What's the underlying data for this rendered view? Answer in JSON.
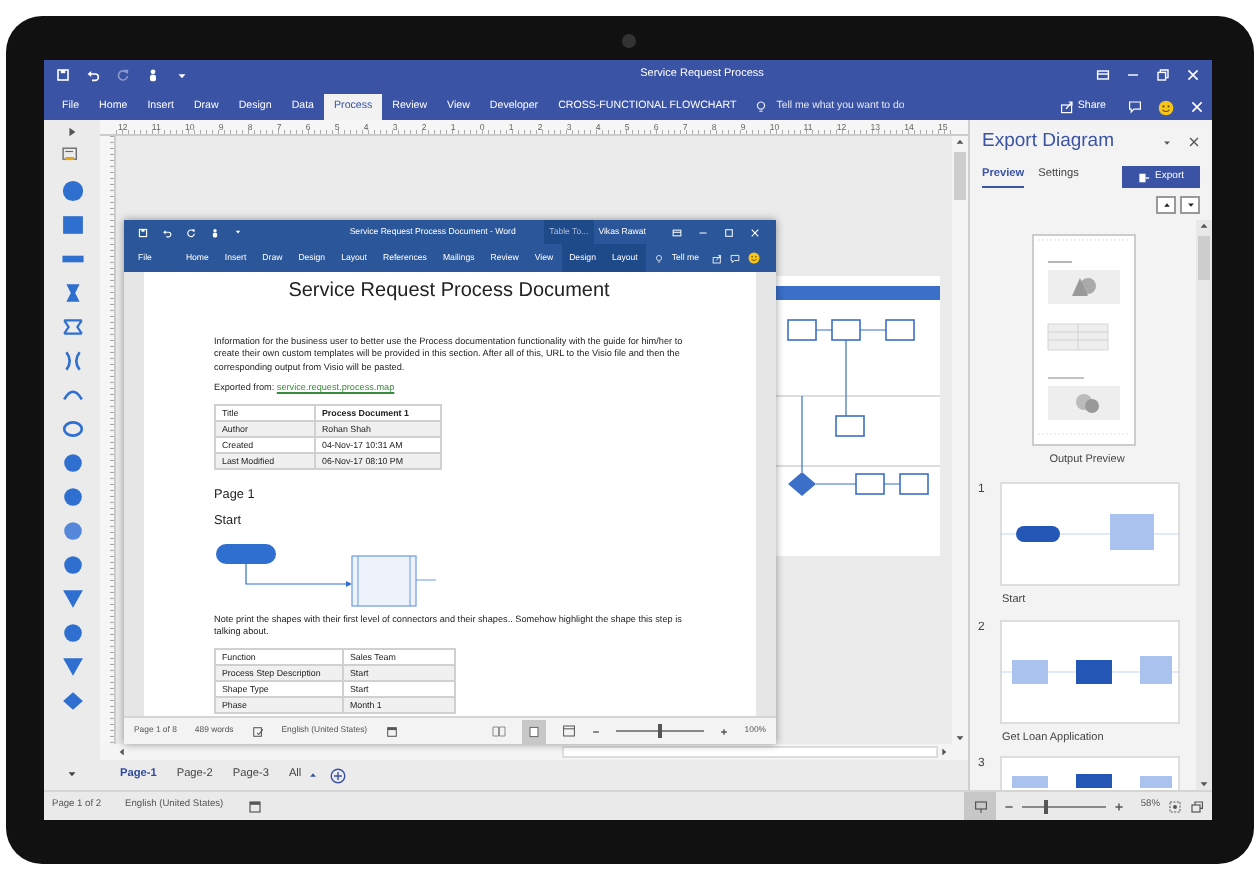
{
  "visio": {
    "title": "Service Request Process",
    "tabs": [
      {
        "label": "File",
        "selected": false
      },
      {
        "label": "Home",
        "selected": false
      },
      {
        "label": "Insert",
        "selected": false
      },
      {
        "label": "Draw",
        "selected": false
      },
      {
        "label": "Design",
        "selected": false
      },
      {
        "label": "Data",
        "selected": false
      },
      {
        "label": "Process",
        "selected": true
      },
      {
        "label": "Review",
        "selected": false
      },
      {
        "label": "View",
        "selected": false
      },
      {
        "label": "Developer",
        "selected": false
      },
      {
        "label": "CROSS-FUNCTIONAL FLOWCHART",
        "selected": false
      }
    ],
    "tell_me": "Tell me what you want to do",
    "share": "Share",
    "ruler_labels": [
      "12",
      "11",
      "10",
      "9",
      "8",
      "7",
      "6",
      "5",
      "4",
      "3",
      "2",
      "1",
      "0",
      "1",
      "2",
      "3",
      "4",
      "5",
      "6",
      "7",
      "8",
      "9",
      "10",
      "11",
      "12",
      "13",
      "14",
      "15"
    ],
    "page_tabs": [
      {
        "label": "Page-1",
        "selected": true
      },
      {
        "label": "Page-2",
        "selected": false
      },
      {
        "label": "Page-3",
        "selected": false
      },
      {
        "label": "All",
        "selected": false
      }
    ],
    "status": {
      "page": "Page 1 of 2",
      "language": "English (United States)",
      "zoom": "58%",
      "level": 0.27
    }
  },
  "word": {
    "title": "Service Request Process Document  -  Word",
    "context": "Table To...",
    "user": "Vikas Rawat",
    "tabs": [
      {
        "label": "File",
        "selected": false,
        "contextual": false
      },
      {
        "label": "Home",
        "selected": false,
        "contextual": false
      },
      {
        "label": "Insert",
        "selected": false,
        "contextual": false
      },
      {
        "label": "Draw",
        "selected": false,
        "contextual": false
      },
      {
        "label": "Design",
        "selected": false,
        "contextual": false
      },
      {
        "label": "Layout",
        "selected": false,
        "contextual": false
      },
      {
        "label": "References",
        "selected": false,
        "contextual": false
      },
      {
        "label": "Mailings",
        "selected": false,
        "contextual": false
      },
      {
        "label": "Review",
        "selected": false,
        "contextual": false
      },
      {
        "label": "View",
        "selected": false,
        "contextual": false
      },
      {
        "label": "Design",
        "selected": false,
        "contextual": true
      },
      {
        "label": "Layout",
        "selected": false,
        "contextual": true
      }
    ],
    "tell_me": "Tell me",
    "document": {
      "heading": "Service Request Process Document",
      "intro": "Information for the business user to better use the Process documentation functionality with the guide for him/her to create their own custom templates will be provided in this section. After all of this, URL to the Visio file and then the corresponding output from Visio will be pasted.",
      "exported_label": "Exported from:",
      "exported_link": "service.request.process.map",
      "meta": [
        {
          "label": "Title",
          "value": "Process Document 1",
          "emphasis": true
        },
        {
          "label": "Author",
          "value": "Rohan Shah",
          "emphasis": false
        },
        {
          "label": "Created",
          "value": "04-Nov-17 10:31 AM",
          "emphasis": false
        },
        {
          "label": "Last Modified",
          "value": "06-Nov-17 08:10 PM",
          "emphasis": false
        }
      ],
      "page_heading": "Page 1",
      "step_heading": "Start",
      "note": "Note print the shapes with their first level of connectors and their shapes.. Somehow highlight the shape this step is talking about.",
      "details": [
        {
          "label": "Function",
          "value": "Sales Team"
        },
        {
          "label": "Process Step Description",
          "value": "Start"
        },
        {
          "label": "Shape Type",
          "value": "Start"
        },
        {
          "label": "Phase",
          "value": "Month 1"
        }
      ]
    },
    "status": {
      "page": "Page 1 of 8",
      "words": "489 words",
      "language": "English (United States)",
      "zoom": "100%",
      "level": 0.5
    }
  },
  "panel": {
    "title": "Export Diagram",
    "tabs": [
      {
        "label": "Preview",
        "selected": true
      },
      {
        "label": "Settings",
        "selected": false
      }
    ],
    "export_button": "Export",
    "output_caption": "Output Preview",
    "pages": [
      {
        "number": "1",
        "caption": "Start"
      },
      {
        "number": "2",
        "caption": "Get Loan Application"
      },
      {
        "number": "3"
      }
    ]
  }
}
